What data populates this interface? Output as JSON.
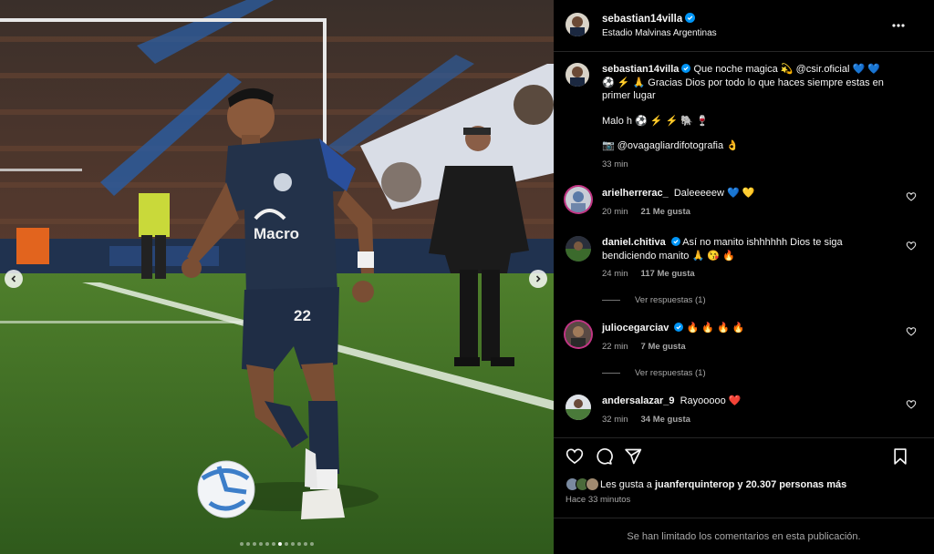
{
  "post": {
    "username": "sebastian14villa",
    "location": "Estadio Malvinas Argentinas",
    "more_icon": "more-horizontal-icon",
    "carousel": {
      "slide_count": 12,
      "active_slide": 6
    }
  },
  "caption": {
    "username": "sebastian14villa",
    "lines": [
      "Que noche magica 💫 @csir.oficial 💙 💙 ⚽",
      "⚡ 🙏 Gracias Dios por todo lo que haces siempre estas en primer lugar",
      "Malo h ⚽ ⚡ ⚡ 🐘 🍷",
      "📷 @ovagagliardifotografia 👌"
    ],
    "time": "33 min"
  },
  "comments": [
    {
      "username": "arielherrerac_",
      "verified": false,
      "text": "Daleeeeew 💙 💛",
      "time": "20 min",
      "likes": "21 Me gusta",
      "replies": ""
    },
    {
      "username": "daniel.chitiva",
      "verified": true,
      "text": "Así no manito ishhhhhh Dios te siga bendiciendo manito 🙏 😘 🔥",
      "time": "24 min",
      "likes": "117 Me gusta",
      "replies": "Ver respuestas (1)"
    },
    {
      "username": "juliocegarciav",
      "verified": true,
      "text": "🔥 🔥 🔥 🔥",
      "time": "22 min",
      "likes": "7 Me gusta",
      "replies": "Ver respuestas (1)"
    },
    {
      "username": "andersalazar_9",
      "verified": false,
      "text": "Rayooooo ❤️",
      "time": "32 min",
      "likes": "34 Me gusta",
      "replies": ""
    }
  ],
  "actions": {
    "like_icon": "heart-icon",
    "comment_icon": "comment-icon",
    "share_icon": "send-icon",
    "save_icon": "bookmark-icon"
  },
  "likes": {
    "prefix": "Les gusta a",
    "user": "juanferquinterop",
    "suffix": "y 20.307 personas más"
  },
  "posted_ago": "Hace 33 minutos",
  "footer": "Se han limitado los comentarios en esta publicación.",
  "colors": {
    "accent_verified": "#0095f6",
    "story_ring": "#c13584",
    "jersey": "#23324a"
  }
}
